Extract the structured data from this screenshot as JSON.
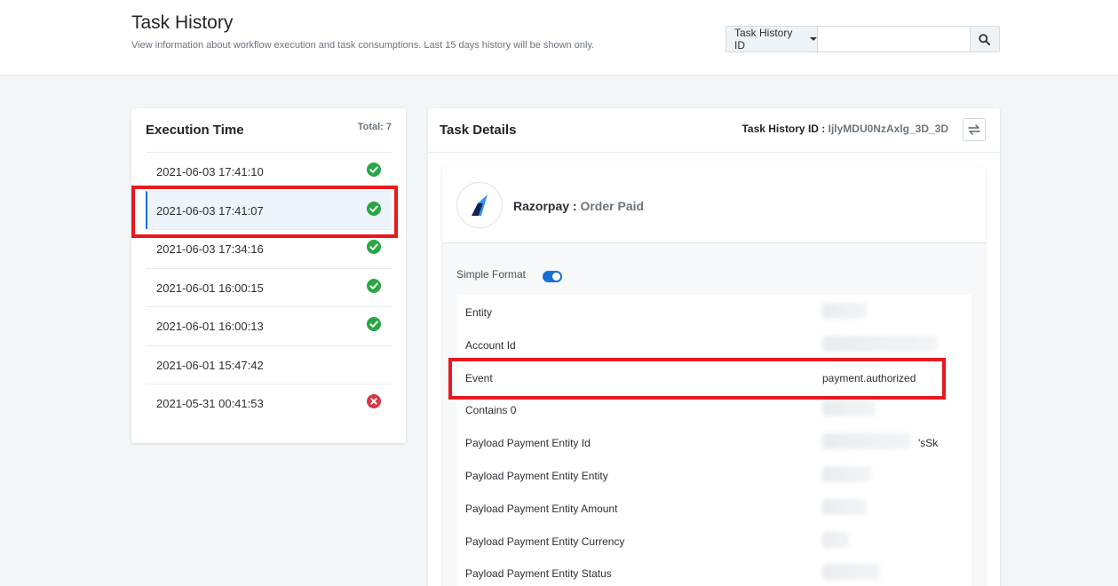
{
  "header": {
    "title": "Task History",
    "subtitle": "View information about workflow execution and task consumptions. Last 15 days history will be shown only.",
    "search_filter": "Task History ID",
    "search_placeholder": ""
  },
  "icons": {
    "search": "search-icon",
    "refresh": "swap-arrows-icon",
    "success": "check-circle-icon",
    "error": "x-circle-icon",
    "app": "razorpay-logo"
  },
  "colors": {
    "accent": "#1a6fd6",
    "success": "#28a745",
    "error": "#dc3545",
    "annotation": "#e8191e"
  },
  "execution": {
    "title": "Execution Time",
    "total_label": "Total: 7",
    "items": [
      {
        "time": "2021-06-03 17:41:10",
        "status": "success",
        "selected": false
      },
      {
        "time": "2021-06-03 17:41:07",
        "status": "success",
        "selected": true
      },
      {
        "time": "2021-06-03 17:34:16",
        "status": "success",
        "selected": false
      },
      {
        "time": "2021-06-01 16:00:15",
        "status": "success",
        "selected": false
      },
      {
        "time": "2021-06-01 16:00:13",
        "status": "success",
        "selected": false
      },
      {
        "time": "2021-06-01 15:47:42",
        "status": "none",
        "selected": false
      },
      {
        "time": "2021-05-31 00:41:53",
        "status": "error",
        "selected": false
      }
    ]
  },
  "details": {
    "title": "Task Details",
    "task_id_label": "Task History ID :",
    "task_id_value": "IjlyMDU0NzAxlg_3D_3D",
    "app_name": "Razorpay :",
    "app_event": "Order Paid",
    "simple_format_label": "Simple Format",
    "simple_format_on": true,
    "fields": [
      {
        "name": "Entity",
        "value": ""
      },
      {
        "name": "Account Id",
        "value": ""
      },
      {
        "name": "Event",
        "value": "payment.authorized"
      },
      {
        "name": "Contains 0",
        "value": ""
      },
      {
        "name": "Payload Payment Entity Id",
        "value": "'sSk"
      },
      {
        "name": "Payload Payment Entity Entity",
        "value": ""
      },
      {
        "name": "Payload Payment Entity Amount",
        "value": ""
      },
      {
        "name": "Payload Payment Entity Currency",
        "value": ""
      },
      {
        "name": "Payload Payment Entity Status",
        "value": ""
      }
    ]
  }
}
